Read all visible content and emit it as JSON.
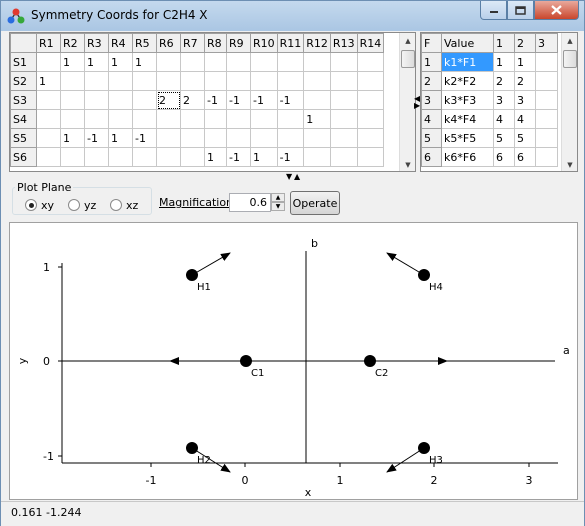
{
  "window": {
    "title": "Symmetry Coords for C2H4 X",
    "colors": {
      "titlebar": "#aac6e3",
      "selection": "#3399ff",
      "close": "#c9462c"
    }
  },
  "coord_grid": {
    "columns": [
      "",
      "R1",
      "R2",
      "R3",
      "R4",
      "R5",
      "R6",
      "R7",
      "R8",
      "R9",
      "R10",
      "R11",
      "R12",
      "R13",
      "R14"
    ],
    "rows": [
      [
        "S1",
        "",
        "1",
        "1",
        "1",
        "1",
        "",
        "",
        "",
        "",
        "",
        "",
        "",
        "",
        ""
      ],
      [
        "S2",
        "1",
        "",
        "",
        "",
        "",
        "",
        "",
        "",
        "",
        "",
        "",
        "",
        "",
        ""
      ],
      [
        "S3",
        "",
        "",
        "",
        "",
        "",
        "2",
        "2",
        "-1",
        "-1",
        "-1",
        "-1",
        "",
        "",
        ""
      ],
      [
        "S4",
        "",
        "",
        "",
        "",
        "",
        "",
        "",
        "",
        "",
        "",
        "",
        "1",
        "",
        ""
      ],
      [
        "S5",
        "",
        "1",
        "-1",
        "1",
        "-1",
        "",
        "",
        "",
        "",
        "",
        "",
        "",
        "",
        ""
      ],
      [
        "S6",
        "",
        "",
        "",
        "",
        "",
        "",
        "",
        "1",
        "-1",
        "1",
        "-1",
        "",
        "",
        ""
      ]
    ]
  },
  "force_grid": {
    "columns": [
      "F",
      "Value",
      "1",
      "2",
      "3"
    ],
    "rows": [
      [
        "1",
        "k1*F1",
        "1",
        "1",
        ""
      ],
      [
        "2",
        "k2*F2",
        "2",
        "2",
        ""
      ],
      [
        "3",
        "k3*F3",
        "3",
        "3",
        ""
      ],
      [
        "4",
        "k4*F4",
        "4",
        "4",
        ""
      ],
      [
        "5",
        "k5*F5",
        "5",
        "5",
        ""
      ],
      [
        "6",
        "k6*F6",
        "6",
        "6",
        ""
      ]
    ]
  },
  "plot_plane": {
    "legend": "Plot Plane",
    "options": [
      {
        "label": "xy",
        "selected": true
      },
      {
        "label": "yz",
        "selected": false
      },
      {
        "label": "xz",
        "selected": false
      }
    ]
  },
  "magnification": {
    "label": "Magnification",
    "value": "0.6"
  },
  "operate_label": "Operate",
  "plot": {
    "x_axis_label": "x",
    "y_axis_label": "y",
    "a_label": "a",
    "b_label": "b",
    "x_ticks": [
      "-1",
      "0",
      "1",
      "2",
      "3"
    ],
    "y_ticks": [
      "1",
      "0",
      "-1"
    ],
    "atoms": [
      "H1",
      "H4",
      "C1",
      "C2",
      "H2",
      "H3"
    ]
  },
  "status": {
    "coords": "0.161  -1.244"
  }
}
